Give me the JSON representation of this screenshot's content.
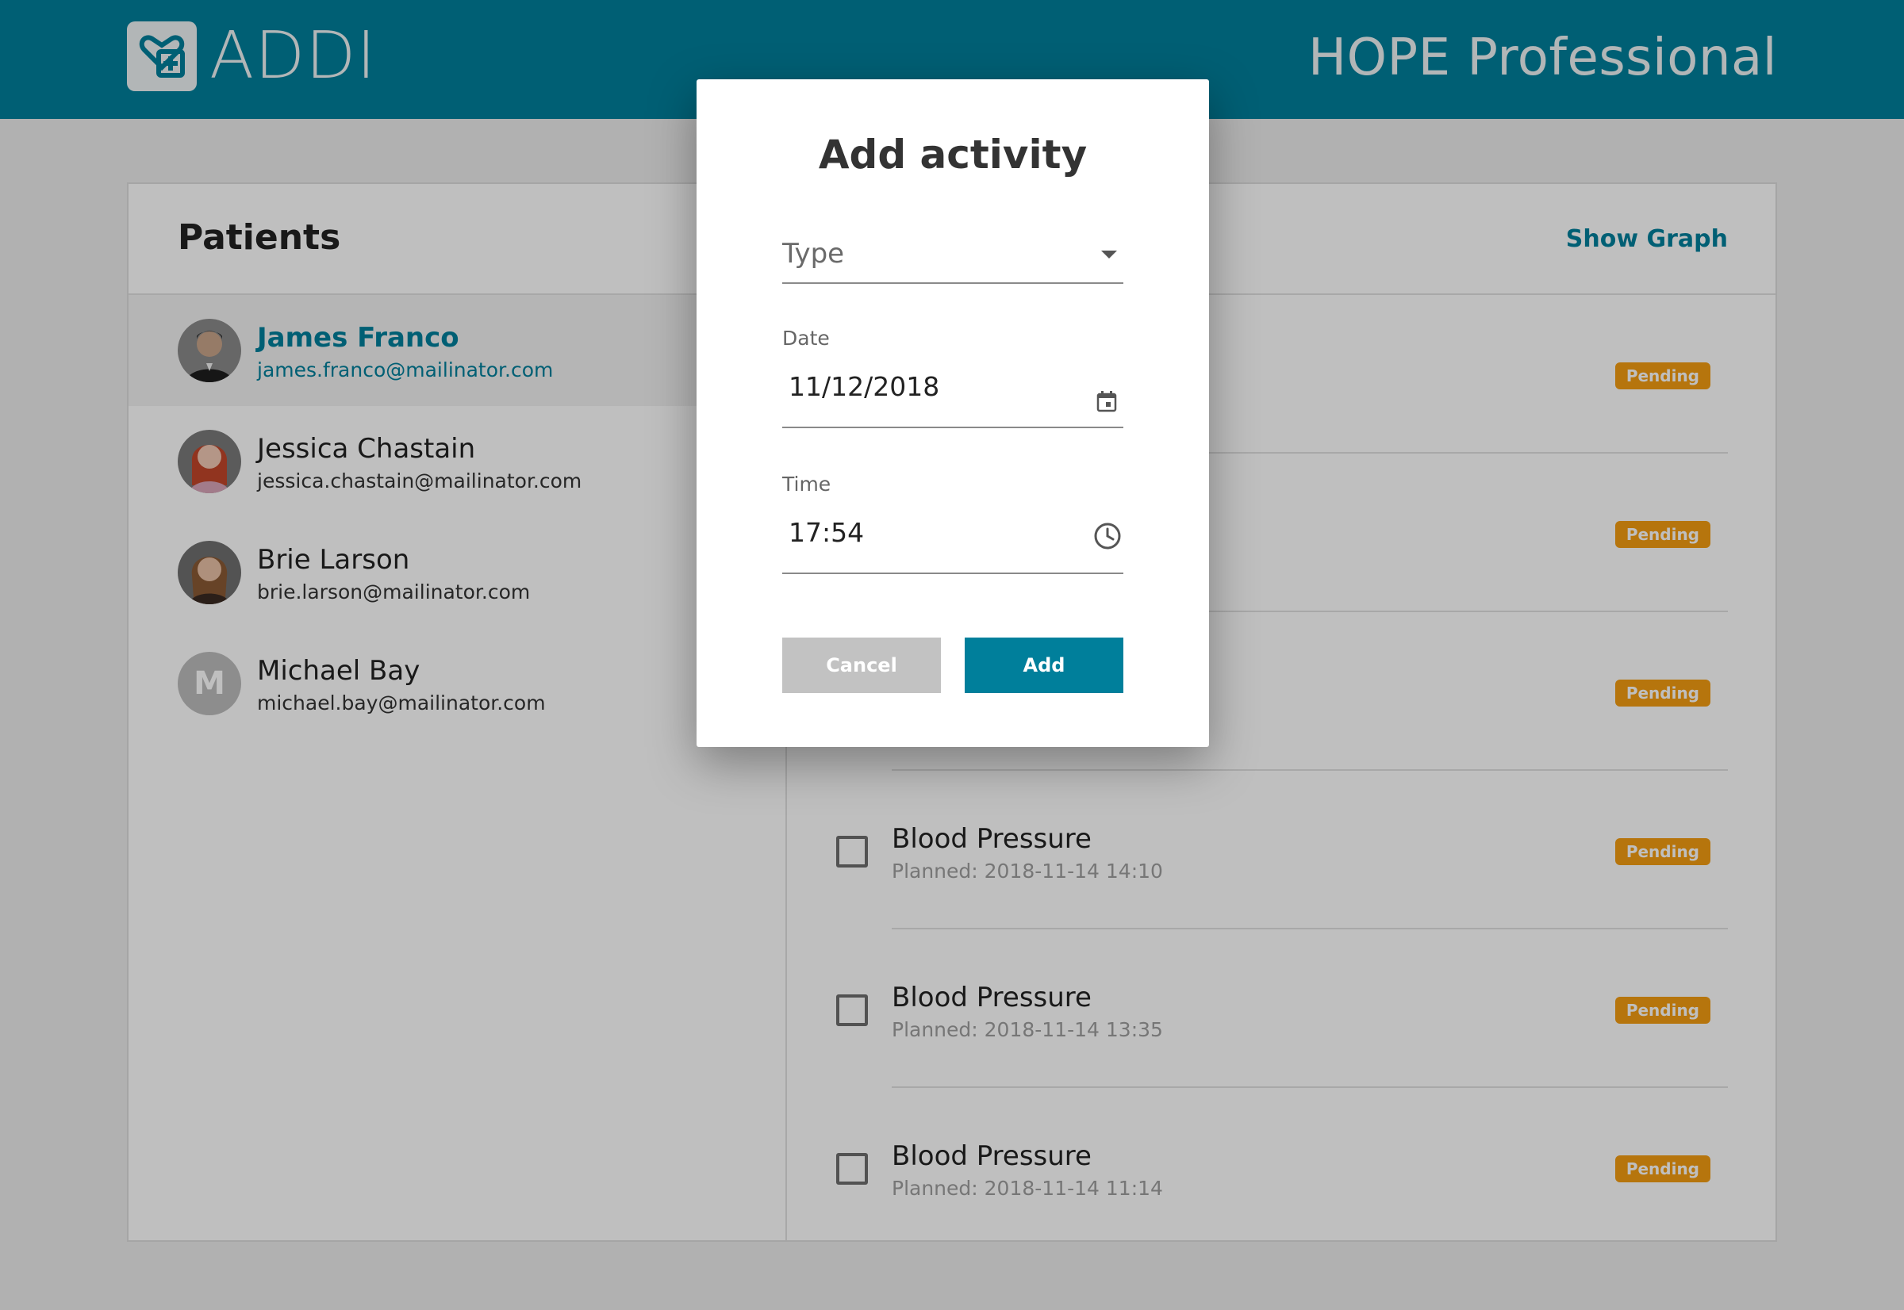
{
  "header": {
    "brand": "ADDI",
    "product": "HOPE Professional"
  },
  "patients_panel": {
    "title": "Patients",
    "show_graph": "Show Graph",
    "patients": [
      {
        "name": "James Franco",
        "email": "james.franco@mailinator.com",
        "selected": true
      },
      {
        "name": "Jessica Chastain",
        "email": "jessica.chastain@mailinator.com"
      },
      {
        "name": "Brie Larson",
        "email": "brie.larson@mailinator.com"
      },
      {
        "name": "Michael Bay",
        "email": "michael.bay@mailinator.com",
        "initial": "M"
      }
    ]
  },
  "activities": [
    {
      "status": "Pending"
    },
    {
      "status": "Pending"
    },
    {
      "status": "Pending"
    },
    {
      "title": "Blood Pressure",
      "planned": "Planned: 2018-11-14 14:10",
      "status": "Pending"
    },
    {
      "title": "Blood Pressure",
      "planned": "Planned: 2018-11-14 13:35",
      "status": "Pending"
    },
    {
      "title": "Blood Pressure",
      "planned": "Planned: 2018-11-14 11:14",
      "status": "Pending"
    }
  ],
  "modal": {
    "title": "Add activity",
    "type_placeholder": "Type",
    "date_label": "Date",
    "date_value": "11/12/2018",
    "time_label": "Time",
    "time_value": "17:54",
    "cancel_label": "Cancel",
    "add_label": "Add"
  },
  "colors": {
    "brand": "#007f9b",
    "pending": "#f39c12"
  }
}
